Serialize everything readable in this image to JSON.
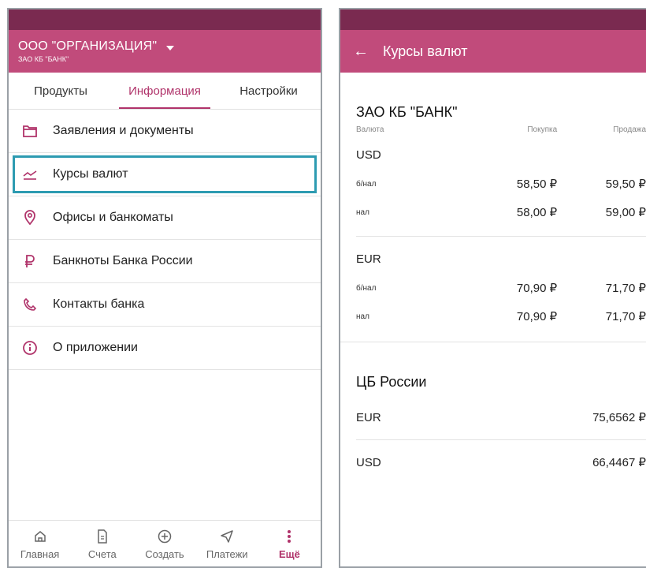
{
  "left": {
    "org": {
      "name": "ООО \"ОРГАНИЗАЦИЯ\"",
      "bank": "ЗАО КБ \"БАНК\""
    },
    "tabs": [
      {
        "label": "Продукты"
      },
      {
        "label": "Информация"
      },
      {
        "label": "Настройки"
      }
    ],
    "menu": [
      {
        "label": "Заявления и документы",
        "icon": "folder-icon"
      },
      {
        "label": "Курсы валют",
        "icon": "chart-line-icon"
      },
      {
        "label": "Офисы и банкоматы",
        "icon": "location-pin-icon"
      },
      {
        "label": "Банкноты Банка России",
        "icon": "ruble-icon"
      },
      {
        "label": "Контакты банка",
        "icon": "phone-icon"
      },
      {
        "label": "О приложении",
        "icon": "info-icon"
      }
    ],
    "nav": [
      {
        "label": "Главная",
        "icon": "home-icon"
      },
      {
        "label": "Счета",
        "icon": "document-icon"
      },
      {
        "label": "Создать",
        "icon": "plus-circle-icon"
      },
      {
        "label": "Платежи",
        "icon": "send-icon"
      },
      {
        "label": "Ещё",
        "icon": "more-vert-icon"
      }
    ]
  },
  "right": {
    "title": "Курсы валют",
    "bank": {
      "title": "ЗАО КБ \"БАНК\"",
      "headers": {
        "currency": "Валюта",
        "buy": "Покупка",
        "sell": "Продажа"
      },
      "usd": {
        "code": "USD",
        "rows": [
          {
            "type": "б/нал",
            "buy": "58,50 ₽",
            "sell": "59,50 ₽"
          },
          {
            "type": "нал",
            "buy": "58,00 ₽",
            "sell": "59,00 ₽"
          }
        ]
      },
      "eur": {
        "code": "EUR",
        "rows": [
          {
            "type": "б/нал",
            "buy": "70,90 ₽",
            "sell": "71,70 ₽"
          },
          {
            "type": "нал",
            "buy": "70,90 ₽",
            "sell": "71,70 ₽"
          }
        ]
      }
    },
    "cb": {
      "title": "ЦБ России",
      "rows": [
        {
          "code": "EUR",
          "value": "75,6562 ₽"
        },
        {
          "code": "USD",
          "value": "66,4467 ₽"
        }
      ]
    }
  },
  "colors": {
    "accent": "#c14b7b",
    "statusbar": "#7a2a50",
    "highlight": "#2d9bb1"
  }
}
